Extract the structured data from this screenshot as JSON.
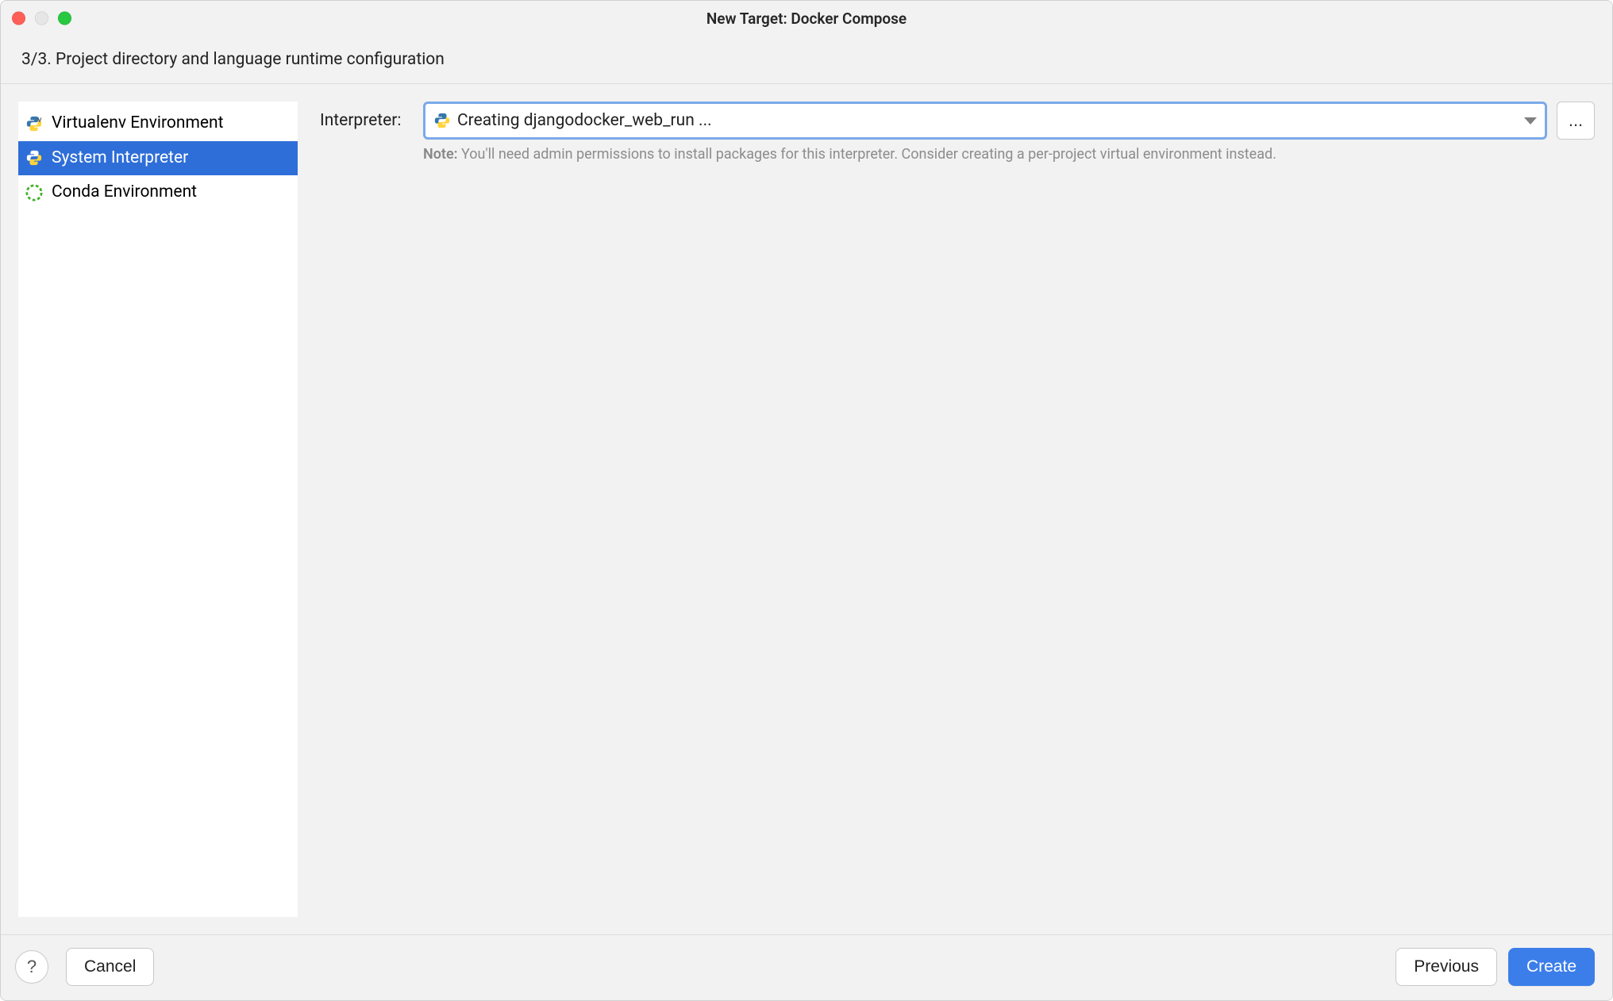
{
  "title": "New Target: Docker Compose",
  "subheader": "3/3. Project directory and language runtime configuration",
  "sidebar": {
    "items": [
      {
        "label": "Virtualenv Environment",
        "icon": "python-v-icon",
        "selected": false
      },
      {
        "label": "System Interpreter",
        "icon": "python-icon",
        "selected": true
      },
      {
        "label": "Conda Environment",
        "icon": "conda-icon",
        "selected": false
      }
    ]
  },
  "form": {
    "interpreter_label": "Interpreter:",
    "interpreter_value": "Creating djangodocker_web_run ...",
    "note_prefix": "Note:",
    "note_text": "You'll need admin permissions to install packages for this interpreter. Consider creating a per-project virtual environment instead.",
    "ellipsis_label": "..."
  },
  "footer": {
    "help_label": "?",
    "cancel_label": "Cancel",
    "previous_label": "Previous",
    "create_label": "Create"
  }
}
